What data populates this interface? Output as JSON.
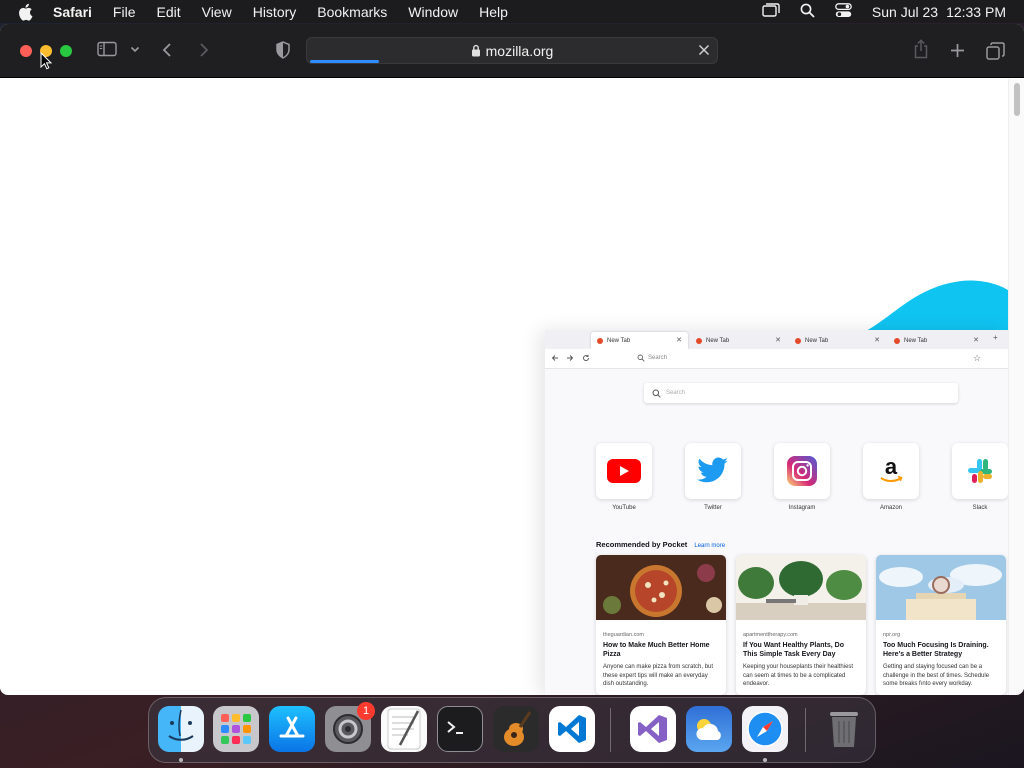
{
  "menubar": {
    "app_name": "Safari",
    "items": [
      "File",
      "Edit",
      "View",
      "History",
      "Bookmarks",
      "Window",
      "Help"
    ],
    "date": "Sun Jul 23",
    "time": "12:33 PM"
  },
  "toolbar": {
    "url": "mozilla.org",
    "load_progress_fraction": 0.17
  },
  "firefox_preview": {
    "tabs": [
      "New Tab",
      "New Tab",
      "New Tab",
      "New Tab"
    ],
    "address_placeholder": "Search",
    "search_placeholder": "Search",
    "top_sites": [
      "YouTube",
      "Twitter",
      "Instagram",
      "Amazon",
      "Slack"
    ],
    "pocket_heading": "Recommended by Pocket",
    "pocket_learn_more": "Learn more",
    "cards": [
      {
        "source": "theguardian.com",
        "title": "How to Make Much Better Home Pizza",
        "description": "Anyone can make pizza from scratch, but these expert tips will make an everyday dish outstanding."
      },
      {
        "source": "apartmenttherapy.com",
        "title": "If You Want Healthy Plants, Do This Simple Task Every Day",
        "description": "Keeping your houseplants their healthiest can seem at times to be a complicated endeavor."
      },
      {
        "source": "npr.org",
        "title": "Too Much Focusing Is Draining. Here's a Better Strategy",
        "description": "Getting and staying focused can be a challenge in the best of times. Schedule some breaks fınto every workday."
      }
    ]
  },
  "dock": {
    "items": [
      "Finder",
      "Launchpad",
      "App Store",
      "System Settings",
      "TextEdit",
      "Terminal",
      "GarageBand",
      "Visual Studio Code",
      "Visual Studio",
      "Weather",
      "Safari",
      "Trash"
    ],
    "settings_badge": "1"
  },
  "colors": {
    "accent_blue": "#2f8cff",
    "close": "#ff5f57",
    "minimize": "#febc2e",
    "zoom": "#28c840",
    "wave_cyan": "#10c4f2"
  }
}
